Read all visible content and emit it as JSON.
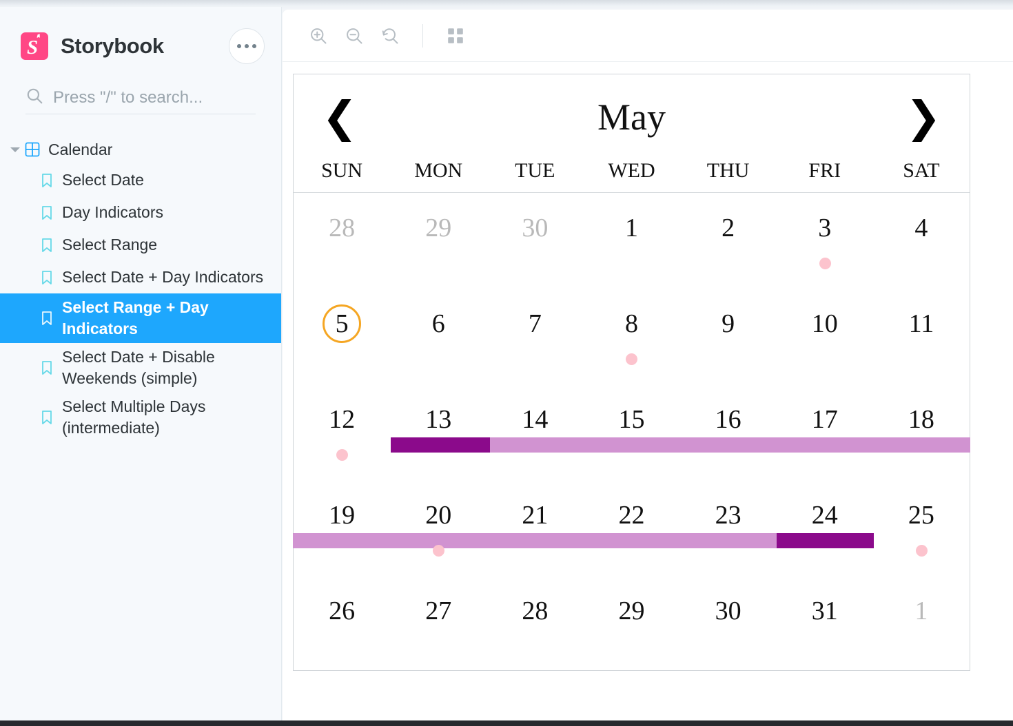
{
  "app": {
    "brand": "Storybook",
    "logo_icon": "storybook-logo-icon",
    "menu_icon": "ellipsis-icon"
  },
  "search": {
    "placeholder": "Press \"/\" to search...",
    "value": "",
    "icon": "search-icon"
  },
  "sidebar": {
    "root": {
      "label": "Calendar",
      "expanded": true,
      "caret_icon": "chevron-down-icon",
      "component_icon": "component-grid-icon"
    },
    "items": [
      {
        "label": "Select Date",
        "icon": "bookmark-icon",
        "selected": false
      },
      {
        "label": "Day Indicators",
        "icon": "bookmark-icon",
        "selected": false
      },
      {
        "label": "Select Range",
        "icon": "bookmark-icon",
        "selected": false
      },
      {
        "label": "Select Date + Day Indicators",
        "icon": "bookmark-icon",
        "selected": false
      },
      {
        "label": "Select Range + Day Indicators",
        "icon": "bookmark-icon",
        "selected": true
      },
      {
        "label": "Select Date + Disable Weekends (simple)",
        "icon": "bookmark-icon",
        "selected": false
      },
      {
        "label": "Select Multiple Days (intermediate)",
        "icon": "bookmark-icon",
        "selected": false
      }
    ]
  },
  "toolbar": {
    "buttons": [
      {
        "name": "zoom-in-button",
        "icon": "zoom-in-icon",
        "title": "Zoom in"
      },
      {
        "name": "zoom-out-button",
        "icon": "zoom-out-icon",
        "title": "Zoom out"
      },
      {
        "name": "zoom-reset-button",
        "icon": "zoom-reset-icon",
        "title": "Reset zoom"
      },
      {
        "name": "grid-button",
        "icon": "grid-icon",
        "title": "Apply a grid to the preview"
      }
    ]
  },
  "calendar": {
    "month": "May",
    "prev_label": "❮",
    "next_label": "❯",
    "prev_icon": "chevron-left-icon",
    "next_icon": "chevron-right-icon",
    "weekdays": [
      "SUN",
      "MON",
      "TUE",
      "WED",
      "THU",
      "FRI",
      "SAT"
    ],
    "today": 5,
    "colors": {
      "today_ring": "#f5a623",
      "indicator_dot": "#fcc3cd",
      "range_selected": "#8b0a8b",
      "range_span": "#d193d1",
      "selected_nav": "#1ea7fd"
    },
    "weeks": [
      [
        {
          "num": "28",
          "muted": true,
          "dot": false
        },
        {
          "num": "29",
          "muted": true,
          "dot": false
        },
        {
          "num": "30",
          "muted": true,
          "dot": false
        },
        {
          "num": "1",
          "muted": false,
          "dot": false
        },
        {
          "num": "2",
          "muted": false,
          "dot": false
        },
        {
          "num": "3",
          "muted": false,
          "dot": true
        },
        {
          "num": "4",
          "muted": false,
          "dot": false
        }
      ],
      [
        {
          "num": "5",
          "muted": false,
          "dot": false,
          "today": true
        },
        {
          "num": "6",
          "muted": false,
          "dot": false
        },
        {
          "num": "7",
          "muted": false,
          "dot": false
        },
        {
          "num": "8",
          "muted": false,
          "dot": true
        },
        {
          "num": "9",
          "muted": false,
          "dot": false
        },
        {
          "num": "10",
          "muted": false,
          "dot": false
        },
        {
          "num": "11",
          "muted": false,
          "dot": false
        }
      ],
      [
        {
          "num": "12",
          "muted": false,
          "dot": true
        },
        {
          "num": "13",
          "muted": false,
          "dot": false
        },
        {
          "num": "14",
          "muted": false,
          "dot": false
        },
        {
          "num": "15",
          "muted": false,
          "dot": false
        },
        {
          "num": "16",
          "muted": false,
          "dot": false
        },
        {
          "num": "17",
          "muted": false,
          "dot": false
        },
        {
          "num": "18",
          "muted": false,
          "dot": false
        }
      ],
      [
        {
          "num": "19",
          "muted": false,
          "dot": false
        },
        {
          "num": "20",
          "muted": false,
          "dot": true
        },
        {
          "num": "21",
          "muted": false,
          "dot": false
        },
        {
          "num": "22",
          "muted": false,
          "dot": false
        },
        {
          "num": "23",
          "muted": false,
          "dot": false
        },
        {
          "num": "24",
          "muted": false,
          "dot": false
        },
        {
          "num": "25",
          "muted": false,
          "dot": true
        }
      ],
      [
        {
          "num": "26",
          "muted": false,
          "dot": false
        },
        {
          "num": "27",
          "muted": false,
          "dot": false
        },
        {
          "num": "28",
          "muted": false,
          "dot": false
        },
        {
          "num": "29",
          "muted": false,
          "dot": false
        },
        {
          "num": "30",
          "muted": false,
          "dot": false
        },
        {
          "num": "31",
          "muted": false,
          "dot": false
        },
        {
          "num": "1",
          "muted": true,
          "dot": false
        }
      ]
    ],
    "range": {
      "start_day": "13",
      "end_day": "24",
      "description": "Range selected from May 13 through May 24"
    }
  }
}
